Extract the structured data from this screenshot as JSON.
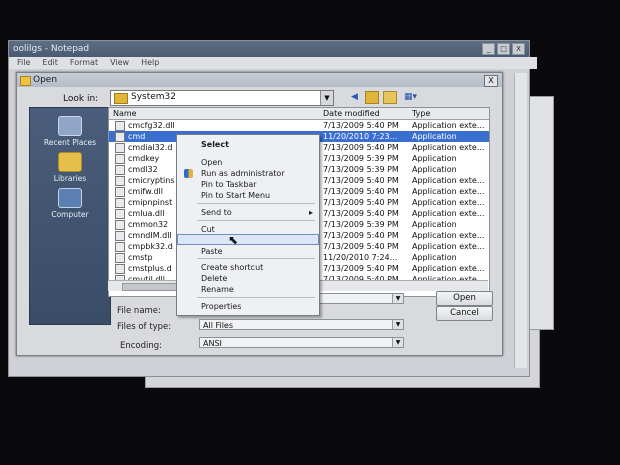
{
  "notepad": {
    "title": "oolilgs - Notepad",
    "menu": [
      "File",
      "Edit",
      "Format",
      "View",
      "Help"
    ],
    "window_buttons": [
      "_",
      "□",
      "X"
    ]
  },
  "dialog": {
    "title": "Open",
    "close_glyph": "X",
    "look_in_label": "Look in:",
    "look_in_value": "System32",
    "places": [
      {
        "label": "Recent Places",
        "icon": "recent-places-icon"
      },
      {
        "label": "Libraries",
        "icon": "libraries-icon"
      },
      {
        "label": "Computer",
        "icon": "computer-icon"
      }
    ],
    "columns": {
      "name": "Name",
      "date": "Date modified",
      "type": "Type"
    },
    "files": [
      {
        "name": "cmcfg32.dll",
        "date": "7/13/2009 5:40 PM",
        "type": "Application exte..."
      },
      {
        "name": "cmd",
        "date": "11/20/2010 7:23...",
        "type": "Application",
        "selected": true
      },
      {
        "name": "cmdial32.d",
        "date": "7/13/2009 5:40 PM",
        "type": "Application exte..."
      },
      {
        "name": "cmdkey",
        "date": "7/13/2009 5:39 PM",
        "type": "Application"
      },
      {
        "name": "cmdl32",
        "date": "7/13/2009 5:39 PM",
        "type": "Application"
      },
      {
        "name": "cmicryptins",
        "date": "7/13/2009 5:40 PM",
        "type": "Application exte..."
      },
      {
        "name": "cmifw.dll",
        "date": "7/13/2009 5:40 PM",
        "type": "Application exte..."
      },
      {
        "name": "cmipnpinst",
        "date": "7/13/2009 5:40 PM",
        "type": "Application exte..."
      },
      {
        "name": "cmlua.dll",
        "date": "7/13/2009 5:40 PM",
        "type": "Application exte..."
      },
      {
        "name": "cmmon32",
        "date": "7/13/2009 5:39 PM",
        "type": "Application"
      },
      {
        "name": "cmndIM.dll",
        "date": "7/13/2009 5:40 PM",
        "type": "Application exte..."
      },
      {
        "name": "cmpbk32.d",
        "date": "7/13/2009 5:40 PM",
        "type": "Application exte..."
      },
      {
        "name": "cmstp",
        "date": "11/20/2010 7:24...",
        "type": "Application"
      },
      {
        "name": "cmstplus.d",
        "date": "7/13/2009 5:40 PM",
        "type": "Application exte..."
      },
      {
        "name": "cmutil.dll",
        "date": "7/13/2009 5:40 PM",
        "type": "Application exte..."
      }
    ],
    "file_name_label": "File name:",
    "file_name_value": "",
    "files_of_type_label": "Files of type:",
    "files_of_type_value": "All Files",
    "encoding_label": "Encoding:",
    "encoding_value": "ANSI",
    "open_button": "Open",
    "cancel_button": "Cancel"
  },
  "context_menu": {
    "header": "Select",
    "items": [
      {
        "label": "Open",
        "group": 1
      },
      {
        "label": "Run as administrator",
        "group": 1,
        "icon": "shield-icon"
      },
      {
        "label": "Pin to Taskbar",
        "group": 1
      },
      {
        "label": "Pin to Start Menu",
        "group": 1
      },
      {
        "label": "Send to",
        "group": 2,
        "submenu": true
      },
      {
        "label": "Cut",
        "group": 3
      },
      {
        "label": "",
        "group": 3,
        "highlighted": true
      },
      {
        "label": "Paste",
        "group": 3
      },
      {
        "label": "Create shortcut",
        "group": 4
      },
      {
        "label": "Delete",
        "group": 4
      },
      {
        "label": "Rename",
        "group": 4
      },
      {
        "label": "Properties",
        "group": 5
      }
    ],
    "submenu_arrow": "▸"
  },
  "colors": {
    "selection": "#3b6fcf",
    "places_panel": "#3f5270",
    "background": "#0a0a0c"
  }
}
